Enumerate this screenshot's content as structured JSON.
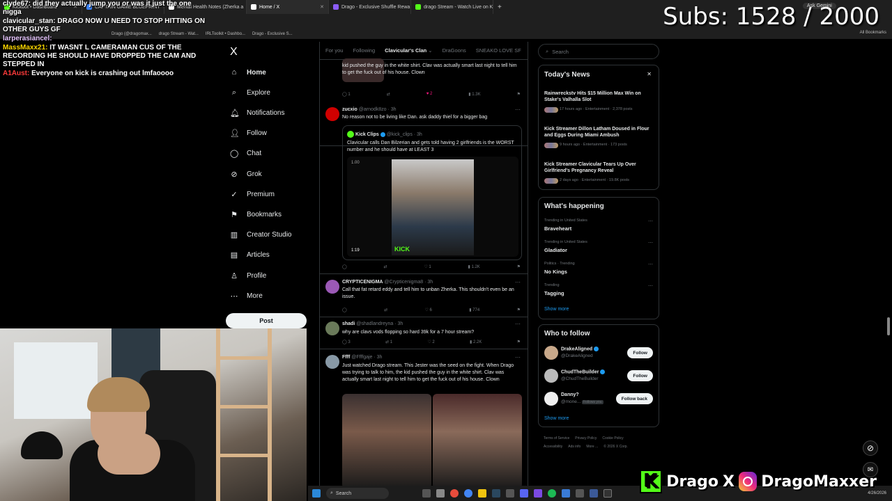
{
  "browser": {
    "tabs": [
      {
        "label": "Kickbot • Dashboard",
        "color": "#53fc18"
      },
      {
        "label": "CAPTAIN GAME BLUEPRINT",
        "color": "#3b82f6"
      },
      {
        "label": "Mental Health Notes (Zherka a",
        "color": "#ffffff"
      },
      {
        "label": "Home / X",
        "color": "#ffffff",
        "active": true
      },
      {
        "label": "Drago - Exclusive Shuffle Rewa",
        "color": "#8b5cf6"
      },
      {
        "label": "drago Stream - Watch Live on K",
        "color": "#53fc18"
      }
    ],
    "new_tab": "+",
    "bookmarks": [
      "Drago (@dragomax...",
      "drago Stream - Wat...",
      "IRLToolkit • Dashbo...",
      "Drago - Exclusive S..."
    ],
    "all_bookmarks": "All Bookmarks",
    "ask_gemini": "Ask Gemini"
  },
  "overlay": {
    "subs": "Subs: 1528 / 2000",
    "chat": [
      {
        "user": "clyde67:",
        "user_color": "#ffffff",
        "text": "did they actually jump you or was it just the one nigga"
      },
      {
        "user": "clavicular_stan:",
        "user_color": "#ffffff",
        "text": "DRAGO NOW U NEED TO STOP HITTING ON OTHER GUYS GF"
      },
      {
        "user": "larperasiancel:",
        "user_color": "#e7c6ff",
        "text": ""
      },
      {
        "user": "MassMaxx21:",
        "user_color": "#ffd700",
        "text": "IT WASNT L CAMERAMAN CUS OF THE RECORDING HE SHOULD HAVE DROPPED THE CAM AND STEPPED IN"
      },
      {
        "user": "A1Aust:",
        "user_color": "#ff3b3b",
        "text": "Everyone on kick is crashing out lmfaoooo"
      }
    ],
    "brand_name_1": "Drago",
    "brand_x": "X",
    "brand_name_2": "DragoMaxxer"
  },
  "x_nav": {
    "logo": "X",
    "items": [
      {
        "label": "Home",
        "icon": "home-icon",
        "glyph": "⌂",
        "bold": true
      },
      {
        "label": "Explore",
        "icon": "search-icon",
        "glyph": "⌕"
      },
      {
        "label": "Notifications",
        "icon": "bell-icon",
        "glyph": "🔔︎"
      },
      {
        "label": "Follow",
        "icon": "person-plus-icon",
        "glyph": "👤︎"
      },
      {
        "label": "Chat",
        "icon": "chat-icon",
        "glyph": "◯"
      },
      {
        "label": "Grok",
        "icon": "grok-icon",
        "glyph": "⊘"
      },
      {
        "label": "Premium",
        "icon": "premium-icon",
        "glyph": "✓"
      },
      {
        "label": "Bookmarks",
        "icon": "bookmark-icon",
        "glyph": "⚑"
      },
      {
        "label": "Creator Studio",
        "icon": "creator-studio-icon",
        "glyph": "▥"
      },
      {
        "label": "Articles",
        "icon": "articles-icon",
        "glyph": "▤"
      },
      {
        "label": "Profile",
        "icon": "profile-icon",
        "glyph": "♙"
      },
      {
        "label": "More",
        "icon": "more-icon",
        "glyph": "⋯"
      }
    ],
    "post_label": "Post"
  },
  "timeline": {
    "tabs": [
      "For you",
      "Following",
      "Clavicular's Clan",
      "DraGoons",
      "SNEAKO LOVE SF"
    ],
    "active_tab": "Clavicular's Clan",
    "tweets": [
      {
        "id": "t0",
        "text": "kid pushed the guy in the white shirt. Clav was actually smart last night to tell him to get the fuck out of his house. Clown",
        "actions": {
          "reply": "1",
          "retweet": "",
          "like": "2",
          "views": "1.3K"
        }
      },
      {
        "id": "t1",
        "name": "zucxio",
        "handle": "@arnodk8zo · 3h",
        "text": "No reason not to be living like Dan. ask daddy thiel for a bigger bag",
        "quote": {
          "name": "Kick Clips",
          "handle": "@kick_clips · 3h",
          "text": "Clavicular calls Dan Bilzerian and gets told having 2 girlfriends is the WORST number and he should have at LEAST 3",
          "video_rate": "1.00",
          "video_time": "1:19",
          "watermark": "KICK"
        },
        "actions": {
          "reply": "",
          "retweet": "",
          "like": "1",
          "views": "1.2K"
        }
      },
      {
        "id": "t2",
        "name": "CRYPTICENIGMA",
        "handle": "@Crypticenigma8 · 3h",
        "text": "Call that fat retard eddy and tell him to unban Zherka. This shouldn't even be an issue.",
        "actions": {
          "reply": "",
          "retweet": "",
          "like": "6",
          "views": "774"
        }
      },
      {
        "id": "t3",
        "name": "shadi",
        "handle": "@shadlandreyna · 3h",
        "text": "why are clavs vods flopping so hard 39k for a 7 hour stream?",
        "actions": {
          "reply": "3",
          "retweet": "1",
          "like": "2",
          "views": "2.2K"
        }
      },
      {
        "id": "t4",
        "name": "Ffff",
        "handle": "@Ffffgaje · 3h",
        "text": "Just watched Drago stream. This Jester  was the seed on the fight. When Drago was trying to talk to him, the kid pushed the guy in the white shirt. Clav was actually smart last night to tell him to get the fuck out of his house. Clown"
      }
    ]
  },
  "right": {
    "search_placeholder": "Search",
    "news": {
      "title": "Today's News",
      "close": "✕",
      "items": [
        {
          "title": "Kick Streamer Dillon Latham Doused in Flour and Eggs During Miami Ambush",
          "meta": "9 hours ago · Entertainment · 173 posts"
        },
        {
          "title": "Kick Streamer Clavicular Tears Up Over Girlfriend's Pregnancy Reveal",
          "meta": "2 days ago · Entertainment · 19.8K posts"
        }
      ],
      "top_item": {
        "title": "Rainwreckstv Hits $15 Million Max Win on Stake's Valhalla Slot",
        "meta": "17 hours ago · Entertainment · 2,378 posts"
      }
    },
    "happening": {
      "title": "What's happening",
      "trends": [
        {
          "cat": "Trending in United States",
          "name": "Braveheart"
        },
        {
          "cat": "Trending in United States",
          "name": "Gladiator"
        },
        {
          "cat": "Politics · Trending",
          "name": "No Kings"
        },
        {
          "cat": "Trending",
          "name": "Tagging"
        }
      ],
      "show_more": "Show more"
    },
    "who_to_follow": {
      "title": "Who to follow",
      "users": [
        {
          "name": "DrakeAligned",
          "handle": "@DrakeAligned",
          "button": "Follow",
          "verified": true
        },
        {
          "name": "ChudTheBuilder",
          "handle": "@ChudTheBuilder",
          "button": "Follow",
          "verified": true
        },
        {
          "name": "Danny?",
          "handle": "@mone...",
          "follows_you": "Follows you",
          "button": "Follow back",
          "verified": false
        }
      ],
      "show_more": "Show more"
    },
    "footer": [
      "Terms of Service",
      "Privacy Policy",
      "Cookie Policy",
      "Accessibility",
      "Ads info",
      "More ...",
      "© 2026 X Corp."
    ]
  },
  "taskbar": {
    "search": "Search",
    "time": "",
    "date": "4/26/2026"
  }
}
